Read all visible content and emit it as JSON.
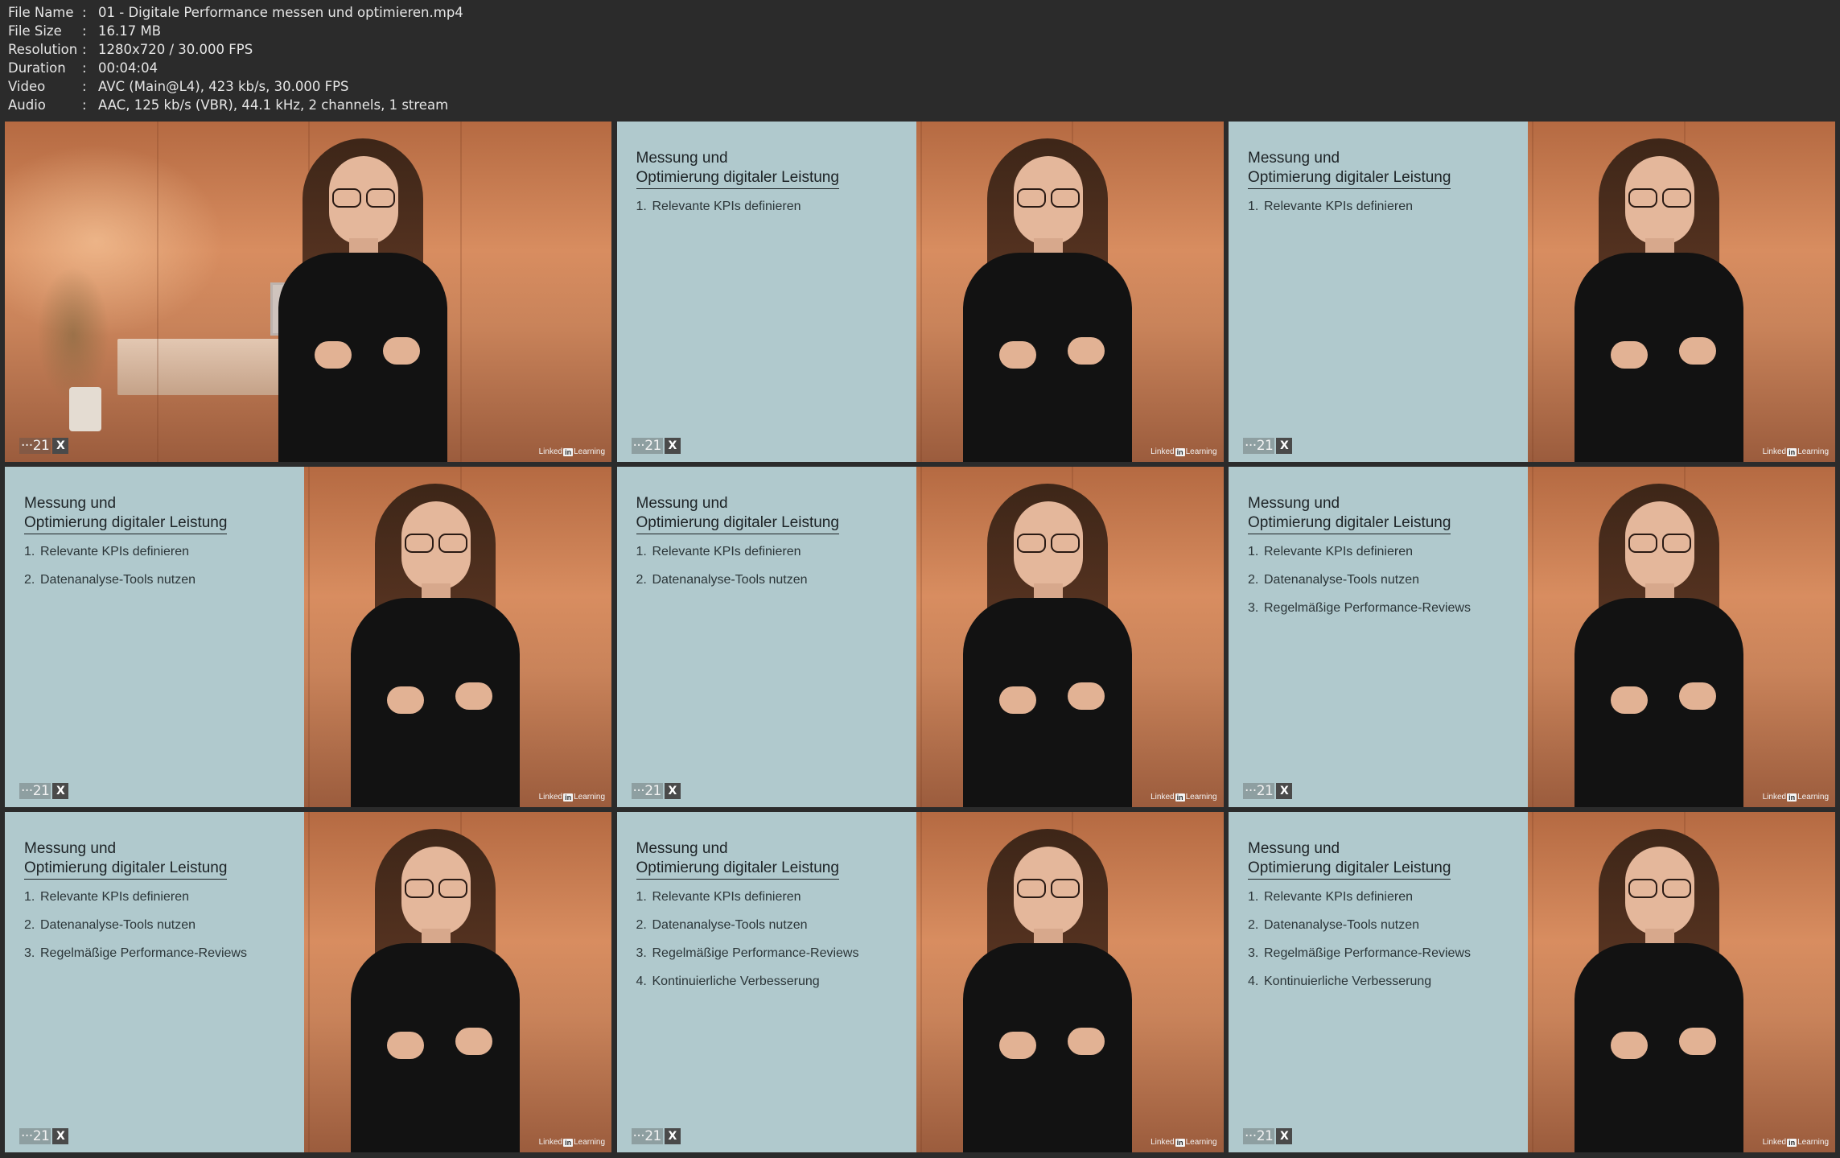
{
  "file_info": [
    {
      "key": "File Name",
      "value": "01 - Digitale Performance messen und optimieren.mp4"
    },
    {
      "key": "File Size",
      "value": "16.17 MB"
    },
    {
      "key": "Resolution",
      "value": "1280x720 / 30.000 FPS"
    },
    {
      "key": "Duration",
      "value": "00:04:04"
    },
    {
      "key": "Video",
      "value": "AVC (Main@L4), 423 kb/s, 30.000 FPS"
    },
    {
      "key": "Audio",
      "value": "AAC, 125 kb/s (VBR), 44.1 kHz, 2 channels, 1 stream"
    }
  ],
  "slide": {
    "title_line1": "Messung und",
    "title_line2": "Optimierung digitaler Leistung",
    "items": [
      "Relevante KPIs definieren",
      "Datenanalyse-Tools nutzen",
      "Regelmäßige Performance-Reviews",
      "Kontinuierliche Verbesserung"
    ]
  },
  "badge": {
    "number": "···21",
    "x": "X"
  },
  "brand": {
    "linked": "Linked",
    "in": "in",
    "learning": "Learning"
  },
  "thumbnails": [
    {
      "type": "full",
      "items_visible": 0
    },
    {
      "type": "slide",
      "items_visible": 1
    },
    {
      "type": "slide",
      "items_visible": 1
    },
    {
      "type": "slide",
      "items_visible": 2
    },
    {
      "type": "slide",
      "items_visible": 2
    },
    {
      "type": "slide",
      "items_visible": 3
    },
    {
      "type": "slide",
      "items_visible": 3
    },
    {
      "type": "slide",
      "items_visible": 4
    },
    {
      "type": "slide",
      "items_visible": 4
    }
  ],
  "colors": {
    "background": "#2b2b2b",
    "slide_panel": "#b0c9cd",
    "office": "#c98058"
  }
}
